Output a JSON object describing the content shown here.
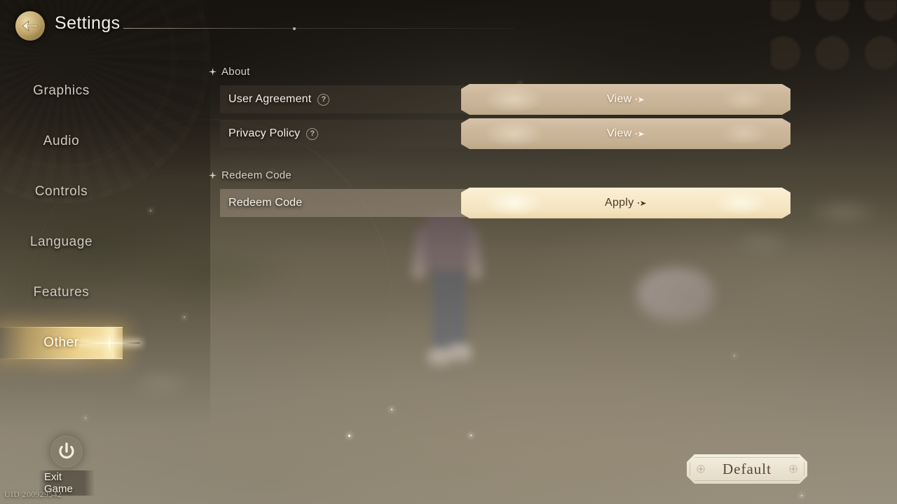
{
  "header": {
    "title": "Settings",
    "back_icon": "back-arrow-medallion-icon"
  },
  "sidebar": {
    "items": [
      {
        "label": "Graphics",
        "active": false
      },
      {
        "label": "Audio",
        "active": false
      },
      {
        "label": "Controls",
        "active": false
      },
      {
        "label": "Language",
        "active": false
      },
      {
        "label": "Features",
        "active": false
      },
      {
        "label": "Other",
        "active": true
      }
    ],
    "exit": {
      "label": "Exit Game",
      "icon": "power-icon"
    },
    "uid": "UID 200929542"
  },
  "main": {
    "sections": [
      {
        "title": "About",
        "bullet_icon": "sparkle-diamond-icon",
        "rows": [
          {
            "label": "User Agreement",
            "help_icon": "question-mark-icon",
            "has_help": true,
            "action": "View",
            "arrow_icon": "dot-arrow-right-icon",
            "highlighted": false
          },
          {
            "label": "Privacy Policy",
            "help_icon": "question-mark-icon",
            "has_help": true,
            "action": "View",
            "arrow_icon": "dot-arrow-right-icon",
            "highlighted": false
          }
        ]
      },
      {
        "title": "Redeem Code",
        "bullet_icon": "sparkle-diamond-icon",
        "rows": [
          {
            "label": "Redeem Code",
            "help_icon": "",
            "has_help": false,
            "action": "Apply",
            "arrow_icon": "dot-arrow-right-icon",
            "highlighted": true
          }
        ]
      }
    ]
  },
  "footer": {
    "default_button": "Default"
  },
  "colors": {
    "accent_gold": "#f0d48c",
    "button_tan": "#cdb79b",
    "button_bright": "#f7e9c8",
    "text_light": "#f4f0e8",
    "text_muted": "#cfc9bd",
    "plaque_cream": "#ece5d3",
    "plaque_text": "#5a4630"
  }
}
